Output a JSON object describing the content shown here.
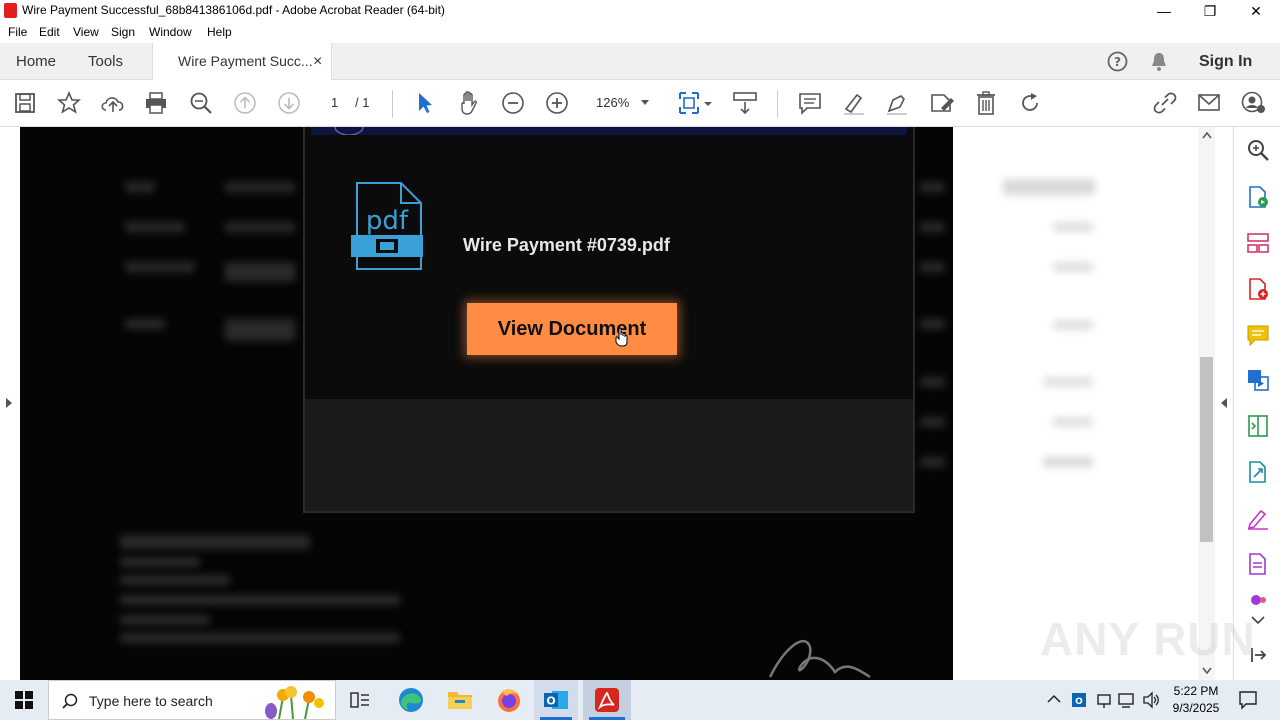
{
  "window": {
    "title": "Wire Payment Successful_68b841386106d.pdf - Adobe Acrobat Reader (64-bit)",
    "minimize": "—",
    "maximize": "❐",
    "close": "✕"
  },
  "menu": [
    "File",
    "Edit",
    "View",
    "Sign",
    "Window",
    "Help"
  ],
  "tabs": {
    "home": "Home",
    "tools": "Tools",
    "document": "Wire Payment Succ...",
    "document_close": "×",
    "sign_in": "Sign In"
  },
  "toolbar": {
    "page_current": "1",
    "page_total": "/ 1",
    "zoom": "126%"
  },
  "modal": {
    "pdf_icon_label": "pdf",
    "filename": "Wire Payment #0739.pdf",
    "button_label": "View Document"
  },
  "watermark": "ANY RUN",
  "taskbar": {
    "search_placeholder": "Type here to search",
    "time": "5:22 PM",
    "date": "9/3/2025"
  },
  "colors": {
    "accent_button": "#ff8c42",
    "pdf_icon": "#3aa0d8",
    "acrobat_red": "#e02020"
  }
}
